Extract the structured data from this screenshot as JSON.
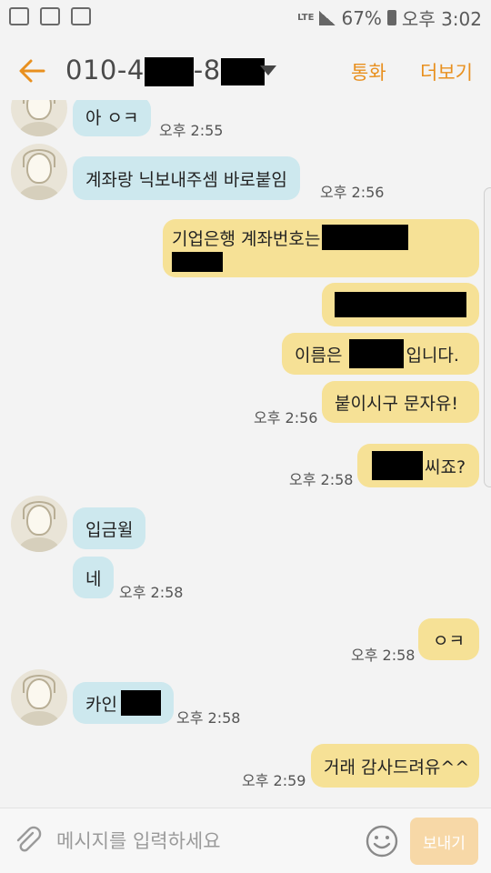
{
  "status": {
    "battery": "67%",
    "time": "오후 3:02",
    "network": "LTE"
  },
  "header": {
    "title_prefix": "010-4",
    "title_mid": "-8",
    "call_label": "통화",
    "more_label": "더보기"
  },
  "messages": {
    "m0": {
      "text": "아 ㅇㅋ",
      "time": "오후 2:55"
    },
    "m1": {
      "text": "계좌랑 닉보내주셈 바로붙임",
      "time": "오후 2:56"
    },
    "m2": {
      "text": "기업은행 계좌번호는"
    },
    "m4": {
      "text_a": "이름은",
      "text_b": "입니다."
    },
    "m5": {
      "text": "붙이시구 문자유!",
      "time": "오후 2:56"
    },
    "m6": {
      "text": "씨죠?",
      "time": "오후 2:58"
    },
    "m7": {
      "text": "입금윌"
    },
    "m8": {
      "text": "네",
      "time": "오후 2:58"
    },
    "m9": {
      "text": "ㅇㅋ",
      "time": "오후 2:58"
    },
    "m10": {
      "text": "카인",
      "time": "오후 2:58"
    },
    "m11": {
      "text": "거래 감사드려유^^",
      "time": "오후 2:59"
    }
  },
  "input": {
    "placeholder": "메시지를 입력하세요",
    "send_label": "보내기"
  },
  "colors": {
    "accent": "#e8901f",
    "incoming": "#cde8ee",
    "outgoing": "#f6e196"
  }
}
